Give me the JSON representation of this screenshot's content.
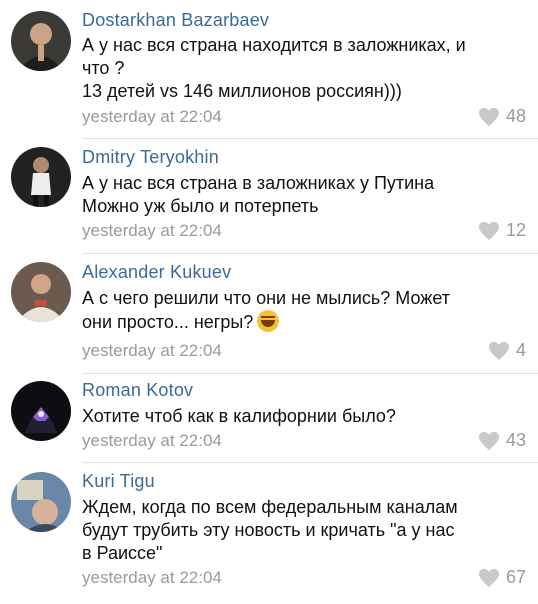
{
  "colors": {
    "author": "#3b6a99",
    "text": "#111111",
    "meta": "#9a9a9a",
    "heart": "#c9c9c9",
    "divider": "#e2e2e2"
  },
  "comments": [
    {
      "author": "Dostarkhan Bazarbaev",
      "lines": [
        "А у нас вся страна находится в заложниках, и",
        "что ?",
        "13 детей vs 146 миллионов россиян)))"
      ],
      "time": "yesterday at 22:04",
      "likes": "48",
      "icon": "heart-icon"
    },
    {
      "author": "Dmitry Teryokhin",
      "lines": [
        "А у нас вся страна в заложниках у Путина",
        "Можно уж было и потерпеть"
      ],
      "time": "yesterday at 22:04",
      "likes": "12",
      "icon": "heart-icon"
    },
    {
      "author": "Alexander Kukuev",
      "lines": [
        "А с чего решили что они не мылись? Может",
        "они просто... негры?"
      ],
      "time": "yesterday at 22:04",
      "likes": "4",
      "icon": "heart-icon",
      "emoji": "rolling-on-floor-laughing"
    },
    {
      "author": "Roman Kotov",
      "lines": [
        "Хотите чтоб как в калифорнии было?"
      ],
      "time": "yesterday at 22:04",
      "likes": "43",
      "icon": "heart-icon"
    },
    {
      "author": "Kuri Tigu",
      "lines": [
        "Ждем, когда по всем федеральным каналам",
        "будут трубить эту новость и кричать \"а у нас",
        "в Раиссе\""
      ],
      "time": "yesterday at 22:04",
      "likes": "67",
      "icon": "heart-icon"
    }
  ]
}
